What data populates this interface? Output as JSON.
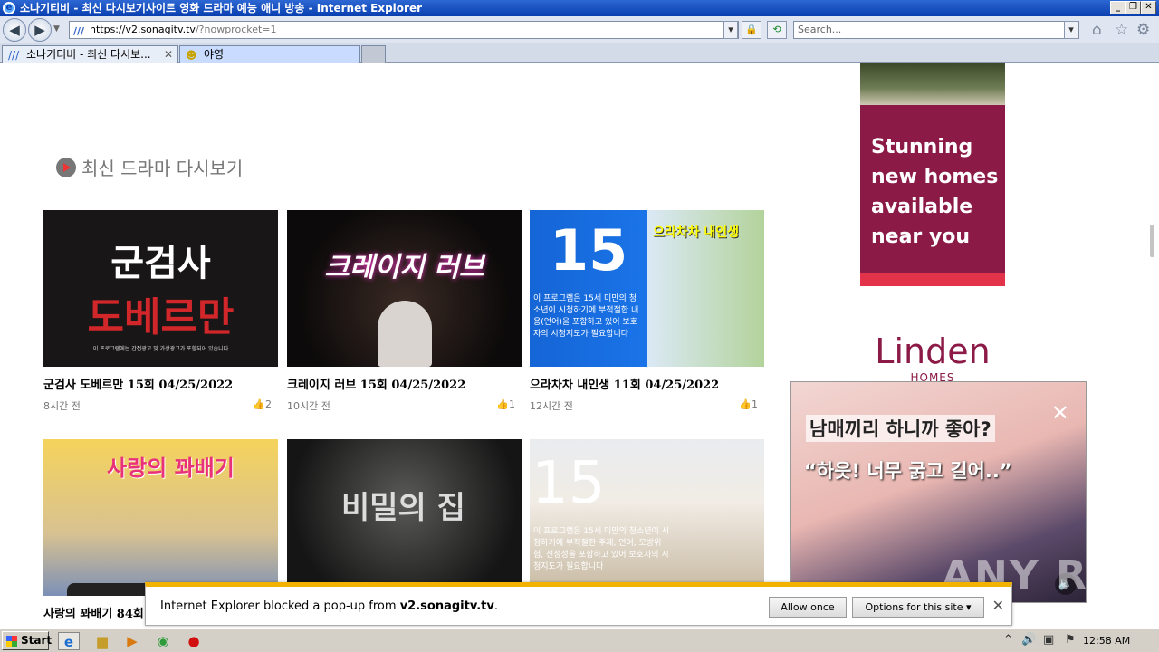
{
  "window": {
    "title": "소나기티비 - 최신 다시보기사이트 영화 드라마 예능 애니 방송 - Internet Explorer",
    "controls": [
      "_",
      "❐",
      "✕"
    ]
  },
  "navbar": {
    "url_prefix": "https://",
    "url_host": "v2.sonagitv.tv",
    "url_path": "/?nowprocket=1",
    "search_placeholder": "Search..."
  },
  "tabs": [
    {
      "label": "소나기티비 - 최신 다시보...",
      "active": true
    },
    {
      "label": "야영",
      "active": false
    }
  ],
  "section": {
    "title": "최신 드라마 다시보기"
  },
  "cards": [
    {
      "title": "군검사 도베르만 15회 04/25/2022",
      "time": "8시간 전",
      "likes": "2"
    },
    {
      "title": "크레이지 러브 15회 04/25/2022",
      "time": "10시간 전",
      "likes": "1"
    },
    {
      "title": "으라차차 내인생 11회 04/25/2022",
      "time": "12시간 전",
      "likes": "1"
    },
    {
      "title": "사랑의 꽈배기 84회",
      "time": "",
      "likes": ""
    },
    {
      "title": "",
      "time": "",
      "likes": ""
    },
    {
      "title": "",
      "time": "",
      "likes": ""
    }
  ],
  "thumbs": {
    "t1_line1": "군검사",
    "t1_line2": "도베르만",
    "t1_caption": "이 프로그램에는 간접광고 및 가상광고가 포함되어 있습니다",
    "t2_text": "크레이지 러브",
    "t3_num": "15",
    "t3_caption": "이 프로그램은 15세 미만의 청소년이 시청하기에 부적절한 내용(언어)을 포함하고 있어 보호자의 시청지도가 필요합니다",
    "t3_show": "으라차차 내인생",
    "t4_text": "사랑의 꽈배기",
    "t5_text": "비밀의 집",
    "t6_num": "15",
    "t6_caption": "이 프로그램은 15세 미만의 청소년이 시청하기에 부적절한 주제, 언어, 모방위험, 선정성을 포함하고 있어 보호자의 시청지도가 필요합니다"
  },
  "ad_right": {
    "headline": "Stunning new homes available near you",
    "logo": "Linden",
    "sub": "HOMES"
  },
  "popup_ad": {
    "line1": "남매끼리 하니까 좋아?",
    "line2": "“하읏! 너무 굵고 길어..”",
    "watermark": "ANY RUN"
  },
  "notification": {
    "text_prefix": "Internet Explorer blocked a pop-up from ",
    "domain": "v2.sonagitv.tv",
    "text_suffix": ".",
    "allow_once": "Allow once",
    "options": "Options for this site ▾"
  },
  "taskbar": {
    "start": "Start",
    "clock": "12:58 AM"
  }
}
